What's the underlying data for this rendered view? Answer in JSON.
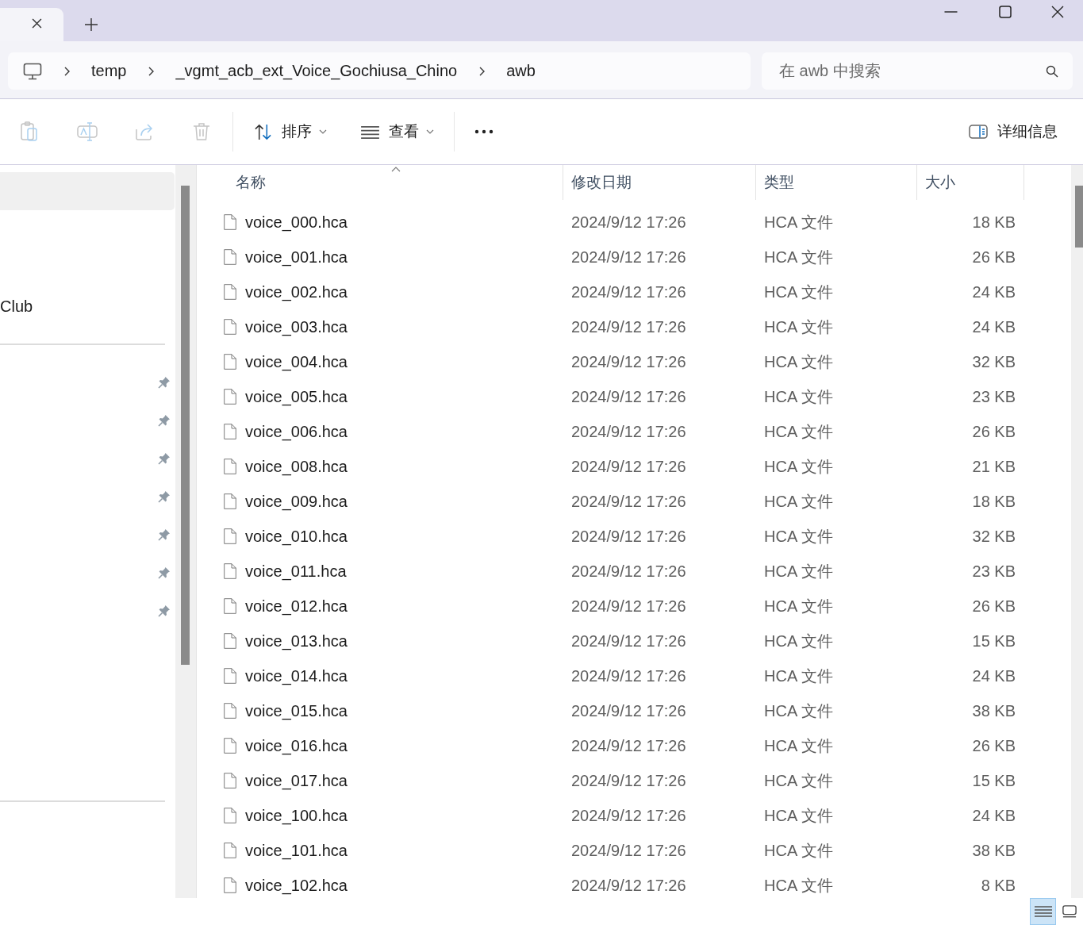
{
  "tabs": [
    {
      "selected": true
    }
  ],
  "address_bar": {
    "segments": [
      "temp",
      "_vgmt_acb_ext_Voice_Gochiusa_Chino",
      "awb"
    ]
  },
  "search": {
    "placeholder": "在 awb 中搜索"
  },
  "toolbar": {
    "actions": [
      {
        "kind": "paste",
        "disabled": true
      },
      {
        "kind": "rename",
        "disabled": true
      },
      {
        "kind": "share",
        "disabled": true
      },
      {
        "kind": "delete",
        "disabled": true
      }
    ],
    "sort": {
      "label": "排序"
    },
    "view": {
      "label": "查看"
    },
    "details": {
      "label": "详细信息"
    }
  },
  "sidebar": {
    "items": [
      {
        "selected": true
      },
      {
        "label": "Club",
        "selected": false
      }
    ],
    "pinned_items": [
      {
        "pinned": true
      },
      {
        "pinned": true
      },
      {
        "pinned": true
      },
      {
        "pinned": true
      },
      {
        "pinned": true
      },
      {
        "pinned": true
      },
      {
        "pinned": true
      }
    ]
  },
  "file_list": {
    "columns": [
      {
        "label": "名称",
        "sorted": true
      },
      {
        "label": "修改日期",
        "sorted": false
      },
      {
        "label": "类型",
        "sorted": false
      },
      {
        "label": "大小",
        "sorted": false
      }
    ],
    "rows": [
      {
        "name": "voice_000.hca",
        "modified": "2024/9/12 17:26",
        "type": "HCA 文件",
        "size": "18 KB"
      },
      {
        "name": "voice_001.hca",
        "modified": "2024/9/12 17:26",
        "type": "HCA 文件",
        "size": "26 KB"
      },
      {
        "name": "voice_002.hca",
        "modified": "2024/9/12 17:26",
        "type": "HCA 文件",
        "size": "24 KB"
      },
      {
        "name": "voice_003.hca",
        "modified": "2024/9/12 17:26",
        "type": "HCA 文件",
        "size": "24 KB"
      },
      {
        "name": "voice_004.hca",
        "modified": "2024/9/12 17:26",
        "type": "HCA 文件",
        "size": "32 KB"
      },
      {
        "name": "voice_005.hca",
        "modified": "2024/9/12 17:26",
        "type": "HCA 文件",
        "size": "23 KB"
      },
      {
        "name": "voice_006.hca",
        "modified": "2024/9/12 17:26",
        "type": "HCA 文件",
        "size": "26 KB"
      },
      {
        "name": "voice_008.hca",
        "modified": "2024/9/12 17:26",
        "type": "HCA 文件",
        "size": "21 KB"
      },
      {
        "name": "voice_009.hca",
        "modified": "2024/9/12 17:26",
        "type": "HCA 文件",
        "size": "18 KB"
      },
      {
        "name": "voice_010.hca",
        "modified": "2024/9/12 17:26",
        "type": "HCA 文件",
        "size": "32 KB"
      },
      {
        "name": "voice_011.hca",
        "modified": "2024/9/12 17:26",
        "type": "HCA 文件",
        "size": "23 KB"
      },
      {
        "name": "voice_012.hca",
        "modified": "2024/9/12 17:26",
        "type": "HCA 文件",
        "size": "26 KB"
      },
      {
        "name": "voice_013.hca",
        "modified": "2024/9/12 17:26",
        "type": "HCA 文件",
        "size": "15 KB"
      },
      {
        "name": "voice_014.hca",
        "modified": "2024/9/12 17:26",
        "type": "HCA 文件",
        "size": "24 KB"
      },
      {
        "name": "voice_015.hca",
        "modified": "2024/9/12 17:26",
        "type": "HCA 文件",
        "size": "38 KB"
      },
      {
        "name": "voice_016.hca",
        "modified": "2024/9/12 17:26",
        "type": "HCA 文件",
        "size": "26 KB"
      },
      {
        "name": "voice_017.hca",
        "modified": "2024/9/12 17:26",
        "type": "HCA 文件",
        "size": "15 KB"
      },
      {
        "name": "voice_100.hca",
        "modified": "2024/9/12 17:26",
        "type": "HCA 文件",
        "size": "24 KB"
      },
      {
        "name": "voice_101.hca",
        "modified": "2024/9/12 17:26",
        "type": "HCA 文件",
        "size": "38 KB"
      },
      {
        "name": "voice_102.hca",
        "modified": "2024/9/12 17:26",
        "type": "HCA 文件",
        "size": "8 KB"
      }
    ]
  },
  "status_bar": {
    "views": [
      {
        "kind": "details",
        "selected": true
      },
      {
        "kind": "tiles",
        "selected": false
      }
    ]
  }
}
